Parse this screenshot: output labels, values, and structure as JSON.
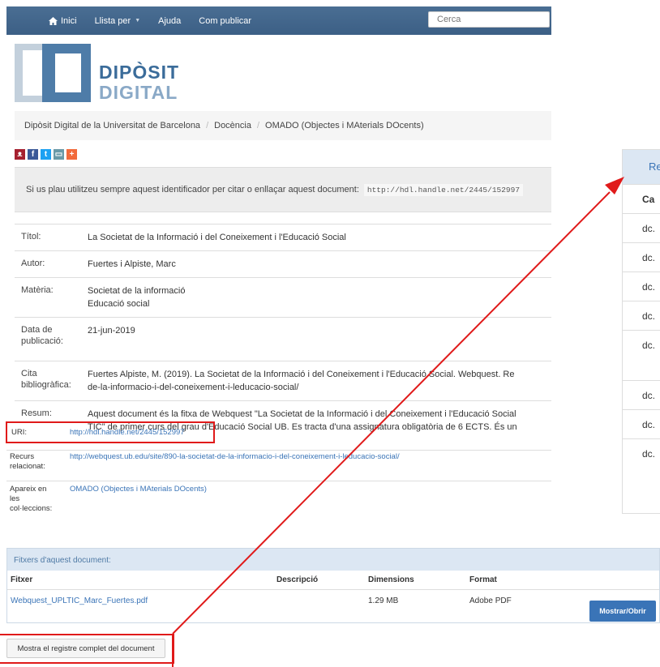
{
  "nav": {
    "home": "Inici",
    "browse": "Llista per",
    "help": "Ajuda",
    "publish": "Com publicar",
    "search_placeholder": "Cerca"
  },
  "logo": {
    "line1": "DIPÒSIT",
    "line2": "DIGITAL"
  },
  "breadcrumb": [
    "Dipòsit Digital de la Universitat de Barcelona",
    "Docència",
    "OMADO (Objectes i MAterials DOcents)"
  ],
  "share_icons": [
    "mendeley-icon",
    "facebook-icon",
    "twitter-icon",
    "print-icon",
    "add-icon"
  ],
  "cite": {
    "text": "Si us plau utilitzeu sempre aquest identificador per citar o enllaçar aquest document:",
    "url": "http://hdl.handle.net/2445/152997"
  },
  "meta": {
    "title_label": "Títol:",
    "title": "La Societat de la Informació i del Coneixement i l'Educació Social",
    "author_label": "Autor:",
    "author": "Fuertes i Alpiste, Marc",
    "subject_label": "Matèria:",
    "subject1": "Societat de la informació",
    "subject2": "Educació social",
    "date_label1": "Data de",
    "date_label2": "publicació:",
    "date": "21-jun-2019",
    "cita_label1": "Cita",
    "cita_label2": "bibliogràfica:",
    "cita1": "Fuertes Alpiste, M. (2019). La Societat de la Informació i del Coneixement i l'Educació Social. Webquest. Re",
    "cita2": "de-la-informacio-i-del-coneixement-i-leducacio-social/",
    "resum_label": "Resum:",
    "resum1": "Aquest document és la fitxa de Webquest \"La Societat de la Informació i del Coneixement i l'Educació Social",
    "resum2": "TIC\" de primer curs del grau d'Educació Social UB. Es tracta d'una assignatura obligatòria de 6 ECTS. És un",
    "uri_label": "URI:",
    "uri": "http://hdl.handle.net/2445/152997",
    "recurs_label1": "Recurs",
    "recurs_label2": "relacionat:",
    "recurs": "http://webquest.ub.edu/site/890-la-societat-de-la-informacio-i-del-coneixement-i-leducacio-social/",
    "coll_label1": "Apareix en",
    "coll_label2": "les",
    "coll_label3": "col·leccions:",
    "coll": "OMADO (Objectes i MAterials DOcents)"
  },
  "rpanel": {
    "head": "Re",
    "rows": [
      "Ca",
      "dc.",
      "dc.",
      "dc.",
      "dc.",
      "dc.",
      "dc.",
      "dc.",
      "dc."
    ]
  },
  "files": {
    "heading": "Fitxers d'aquest document:",
    "col_file": "Fitxer",
    "col_desc": "Descripció",
    "col_size": "Dimensions",
    "col_format": "Format",
    "file_name": "Webquest_UPLTIC_Marc_Fuertes.pdf",
    "file_size": "1.29 MB",
    "file_format": "Adobe PDF",
    "open_label": "Mostrar/Obrir"
  },
  "full_record_label": "Mostra el registre complet del document",
  "colors": {
    "nav": "#3c5f85",
    "link": "#3a74b7",
    "highlight": "#e01a1a"
  }
}
